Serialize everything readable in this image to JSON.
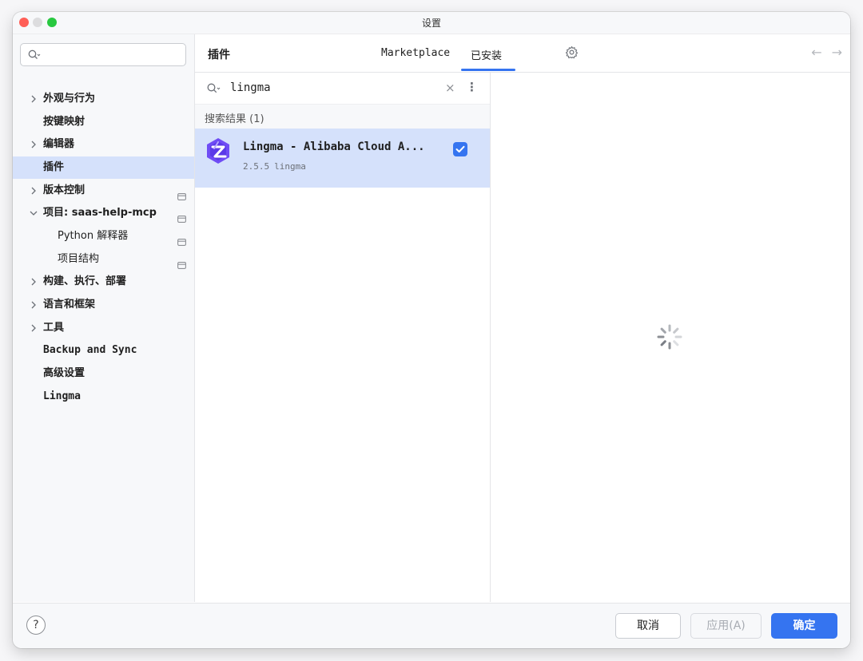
{
  "window": {
    "title": "设置",
    "traffic_lights": [
      "close",
      "minimize",
      "zoom"
    ]
  },
  "sidebar": {
    "search": {
      "value": "",
      "placeholder": ""
    },
    "items": [
      {
        "label": "外观与行为",
        "expandable": true,
        "expanded": false,
        "level": 0
      },
      {
        "label": "按键映射",
        "expandable": false,
        "level": 0
      },
      {
        "label": "编辑器",
        "expandable": true,
        "expanded": false,
        "level": 0
      },
      {
        "label": "插件",
        "expandable": false,
        "level": 0,
        "selected": true
      },
      {
        "label": "版本控制",
        "expandable": true,
        "expanded": false,
        "level": 0,
        "project_icon": true
      },
      {
        "label": "项目: saas-help-mcp",
        "expandable": true,
        "expanded": true,
        "level": 0,
        "project_icon": true
      },
      {
        "label": "Python 解释器",
        "expandable": false,
        "level": 1,
        "project_icon": true
      },
      {
        "label": "项目结构",
        "expandable": false,
        "level": 1,
        "project_icon": true
      },
      {
        "label": "构建、执行、部署",
        "expandable": true,
        "expanded": false,
        "level": 0
      },
      {
        "label": "语言和框架",
        "expandable": true,
        "expanded": false,
        "level": 0
      },
      {
        "label": "工具",
        "expandable": true,
        "expanded": false,
        "level": 0
      },
      {
        "label": "Backup and Sync",
        "expandable": false,
        "level": 0
      },
      {
        "label": "高级设置",
        "expandable": false,
        "level": 0
      },
      {
        "label": "Lingma",
        "expandable": false,
        "level": 0
      }
    ]
  },
  "plugins_header": {
    "title": "插件",
    "tabs": [
      {
        "label": "Marketplace",
        "active": false
      },
      {
        "label": "已安装",
        "active": true
      }
    ],
    "icons": [
      "gear-icon",
      "back-arrow-icon",
      "forward-arrow-icon"
    ]
  },
  "plugin_search": {
    "query": "lingma"
  },
  "results": {
    "header": "搜索结果 (1)",
    "items": [
      {
        "name": "Lingma - Alibaba Cloud A...",
        "version": "2.5.5",
        "vendor": "lingma",
        "enabled": true,
        "selected": true
      }
    ]
  },
  "detail": {
    "state": "loading"
  },
  "footer": {
    "help": "?",
    "cancel": "取消",
    "apply": "应用(A)",
    "ok": "确定"
  },
  "colors": {
    "accent": "#3574f0",
    "selection": "#d5e1fb",
    "panel_bg": "#f7f8fa"
  }
}
